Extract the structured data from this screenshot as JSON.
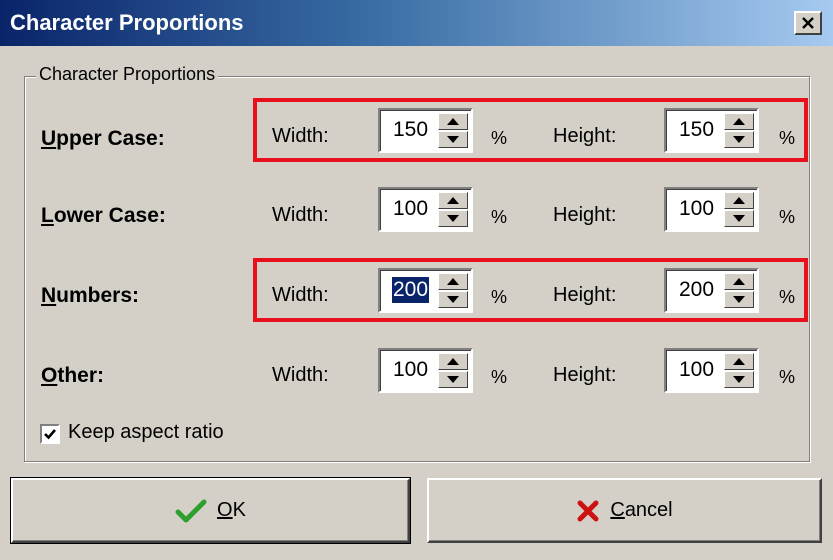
{
  "window": {
    "title": "Character Proportions",
    "close_glyph": "✕"
  },
  "group": {
    "label": "Character Proportions"
  },
  "labels": {
    "width": "Width:",
    "height": "Height:",
    "percent": "%"
  },
  "rows": [
    {
      "key": "U",
      "rest": "pper Case:",
      "width": "150",
      "height": "150",
      "highlighted": true
    },
    {
      "key": "L",
      "rest": "ower Case:",
      "width": "100",
      "height": "100",
      "highlighted": false
    },
    {
      "key": "N",
      "rest": "umbers:",
      "width": "200",
      "height": "200",
      "highlighted": true,
      "width_selected": true
    },
    {
      "key": "O",
      "rest": "ther:",
      "width": "100",
      "height": "100",
      "highlighted": false
    }
  ],
  "keep_aspect": {
    "label": "Keep aspect ratio",
    "checked": true
  },
  "buttons": {
    "ok": {
      "key": "O",
      "rest": "K",
      "icon": "checkmark-icon"
    },
    "cancel": {
      "key": "C",
      "rest": "ancel",
      "icon": "x-icon"
    }
  },
  "colors": {
    "highlight": "#e8101c",
    "ok_icon": "#2e9e2e",
    "cancel_icon": "#cc1111",
    "title_bar": "#0a246a"
  }
}
